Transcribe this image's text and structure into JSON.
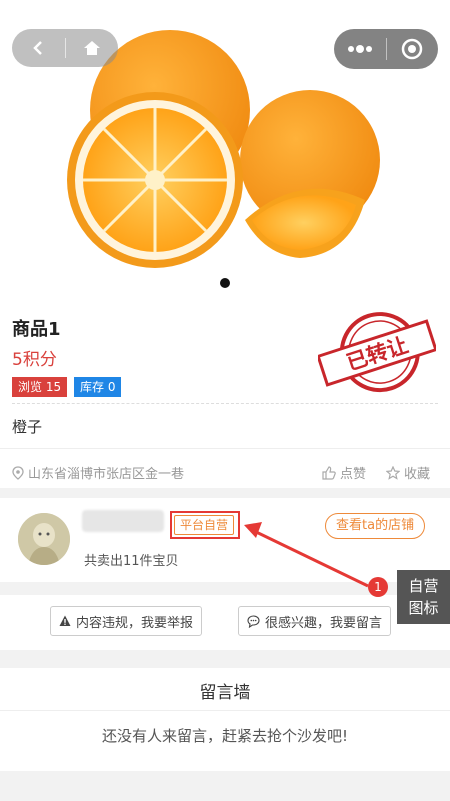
{
  "product": {
    "title": "商品1",
    "points": "5积分",
    "views_badge": "浏览 15",
    "stock_badge": "库存 0",
    "description": "橙子",
    "location": "山东省淄博市张店区金一巷",
    "like_label": "点赞",
    "favorite_label": "收藏",
    "stamp_text": "已转让"
  },
  "seller": {
    "self_tag": "平台自营",
    "sold_text": "共卖出11件宝贝",
    "shop_button": "查看ta的店铺"
  },
  "actions": {
    "report": "内容违规，我要举报",
    "message": "很感兴趣，我要留言"
  },
  "wall": {
    "title": "留言墙",
    "empty": "还没有人来留言，赶紧去抢个沙发吧!"
  },
  "annotation": {
    "number": "1",
    "label_line1": "自营",
    "label_line2": "图标"
  },
  "colors": {
    "accent_red": "#d9413c",
    "accent_blue": "#1f86e6",
    "accent_orange": "#ee8a3a"
  }
}
